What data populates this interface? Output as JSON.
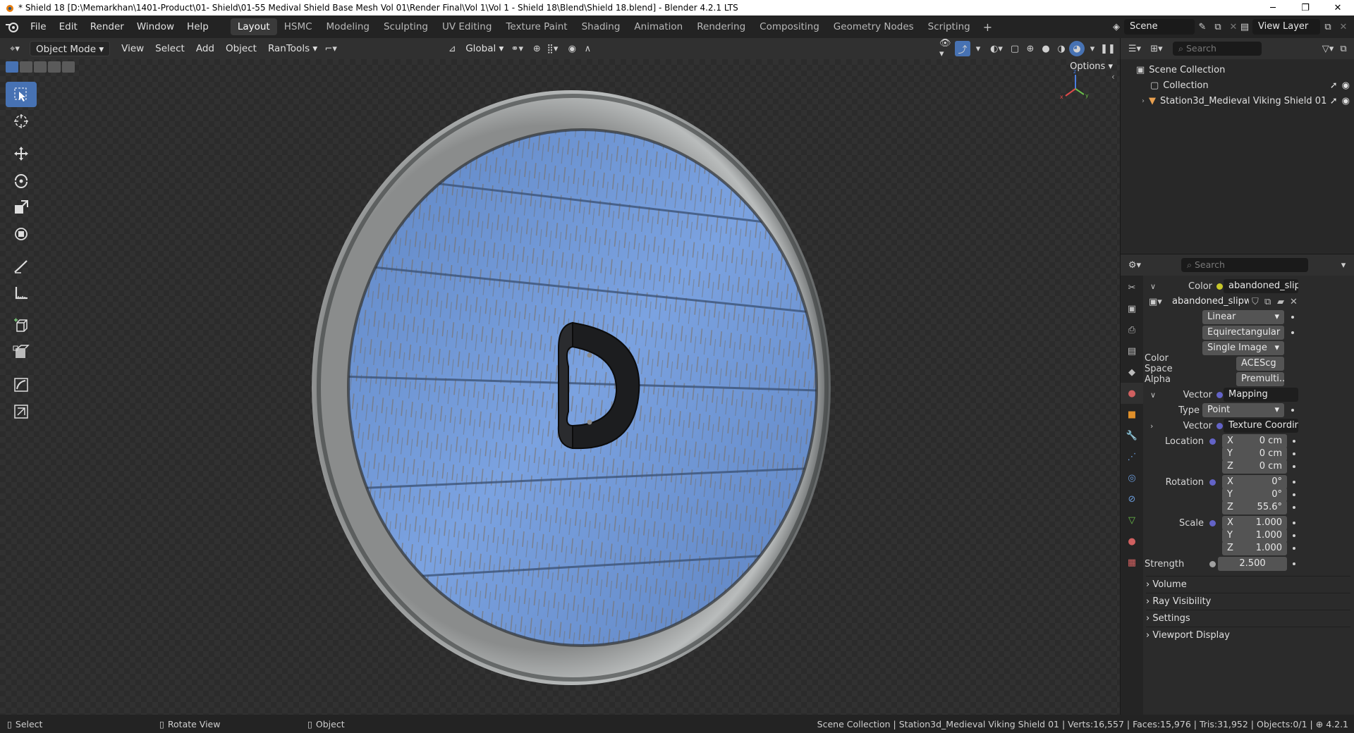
{
  "window": {
    "title": "* Shield 18 [D:\\Memarkhan\\1401-Product\\01- Shield\\01-55 Medival Shield Base Mesh Vol 01\\Render Final\\Vol 1\\Vol 1 - Shield 18\\Blend\\Shield 18.blend] - Blender 4.2.1 LTS",
    "minimize": "─",
    "maximize": "❐",
    "close": "✕"
  },
  "menu": [
    "File",
    "Edit",
    "Render",
    "Window",
    "Help"
  ],
  "workspaces": [
    "Layout",
    "HSMC",
    "Modeling",
    "Sculpting",
    "UV Editing",
    "Texture Paint",
    "Shading",
    "Animation",
    "Rendering",
    "Compositing",
    "Geometry Nodes",
    "Scripting"
  ],
  "active_workspace": "Layout",
  "scene": {
    "name": "Scene",
    "view_layer": "View Layer"
  },
  "viewport_header": {
    "mode": "Object Mode",
    "menus": [
      "View",
      "Select",
      "Add",
      "Object",
      "RanTools"
    ],
    "transform_orientation": "Global",
    "options": "Options"
  },
  "outliner": {
    "search_placeholder": "Search",
    "items": [
      {
        "label": "Scene Collection"
      },
      {
        "label": "Collection"
      },
      {
        "label": "Station3d_Medieval Viking Shield 01"
      }
    ]
  },
  "properties": {
    "search_placeholder": "Search",
    "color_label": "Color",
    "color_value": "abandoned_slipwa...",
    "image_name": "abandoned_slipway_...",
    "interpolation": "Linear",
    "projection": "Equirectangular",
    "source": "Single Image",
    "color_space_label": "Color Space",
    "color_space": "ACEScg",
    "alpha_label": "Alpha",
    "alpha": "Premulti...",
    "vector_label": "Vector",
    "vector_value": "Mapping",
    "type_label": "Type",
    "type_value": "Point",
    "vector2_label": "Vector",
    "vector2_value": "Texture Coordinat...",
    "location_label": "Location",
    "location": {
      "x": "0 cm",
      "y": "0 cm",
      "z": "0 cm"
    },
    "rotation_label": "Rotation",
    "rotation": {
      "x": "0°",
      "y": "0°",
      "z": "55.6°"
    },
    "scale_label": "Scale",
    "scale": {
      "x": "1.000",
      "y": "1.000",
      "z": "1.000"
    },
    "strength_label": "Strength",
    "strength": "2.500",
    "axis": {
      "x": "X",
      "y": "Y",
      "z": "Z"
    },
    "panels": [
      "Volume",
      "Ray Visibility",
      "Settings",
      "Viewport Display"
    ]
  },
  "statusbar": {
    "select": "Select",
    "rotate_view": "Rotate View",
    "object": "Object",
    "info": "Scene Collection | Station3d_Medieval Viking Shield 01 | Verts:16,557 | Faces:15,976 | Tris:31,952 | Objects:0/1 |",
    "version": "4.2.1"
  },
  "colors": {
    "accent": "#4772b3",
    "shield_blue": "#6d95d6",
    "socket_yellow": "#c7c729",
    "socket_purple": "#6363c7"
  },
  "icons": [
    "blender-logo-icon",
    "cursor-select-icon",
    "cursor-icon",
    "move-icon",
    "rotate-icon",
    "scale-icon",
    "transform-icon",
    "annotate-icon",
    "measure-icon",
    "add-cube-icon",
    "shear-icon",
    "eye-icon",
    "filter-icon"
  ]
}
